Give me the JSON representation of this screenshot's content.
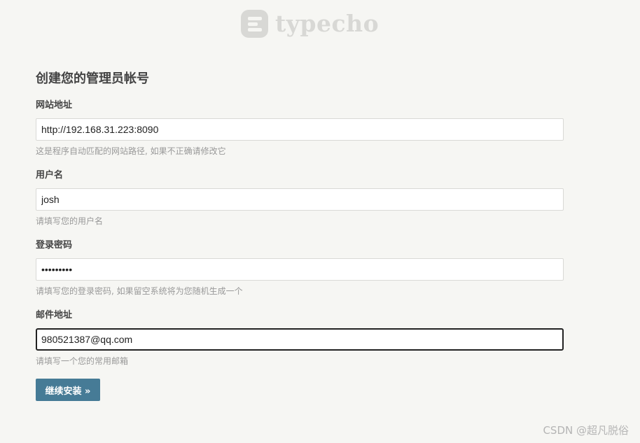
{
  "logo": {
    "text": "typecho"
  },
  "form": {
    "heading": "创建您的管理员帐号",
    "fields": [
      {
        "label": "网站地址",
        "value": "http://192.168.31.223:8090",
        "hint": "这是程序自动匹配的网站路径, 如果不正确请修改它"
      },
      {
        "label": "用户名",
        "value": "josh",
        "hint": "请填写您的用户名"
      },
      {
        "label": "登录密码",
        "value": "•••••••••",
        "hint": "请填写您的登录密码, 如果留空系统将为您随机生成一个"
      },
      {
        "label": "邮件地址",
        "value": "980521387@qq.com",
        "hint": "请填写一个您的常用邮箱"
      }
    ],
    "submit_label": "继续安装 »"
  },
  "watermark": {
    "text": "CSDN @超凡脱俗"
  },
  "colors": {
    "background": "#f6f6f3",
    "button": "#467b96",
    "logo": "#d8d8d5",
    "hint": "#999999"
  }
}
